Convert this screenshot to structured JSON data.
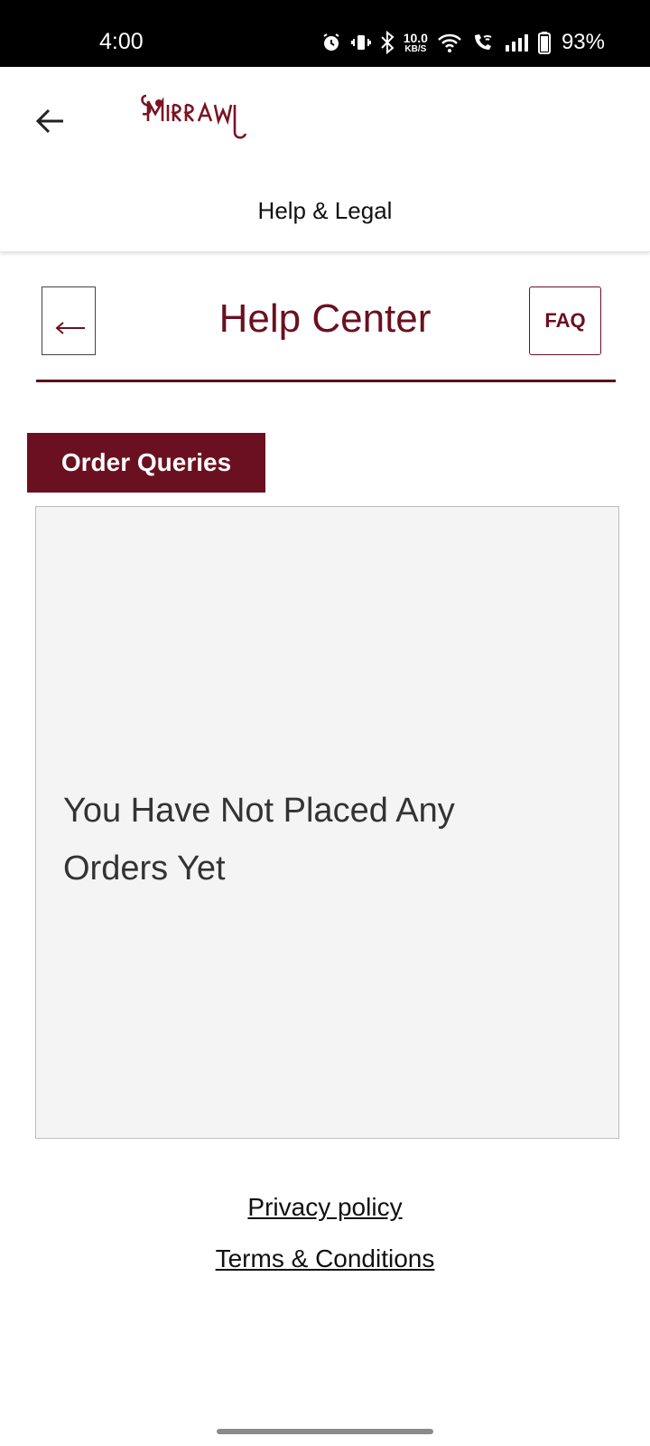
{
  "status_bar": {
    "time": "4:00",
    "net_speed_value": "10.0",
    "net_speed_unit": "KB/S",
    "battery": "93%",
    "icons": [
      "alarm-icon",
      "vibrate-icon",
      "bluetooth-icon",
      "wifi-icon",
      "wifi-calling-icon",
      "signal-icon",
      "battery-icon"
    ]
  },
  "header": {
    "brand": "MIRRAW",
    "subtitle": "Help & Legal"
  },
  "help_center": {
    "title": "Help Center",
    "faq_label": "FAQ",
    "back_glyph": "←"
  },
  "tabs": {
    "active_label": "Order Queries"
  },
  "orders": {
    "empty_message": "You Have Not Placed Any Orders Yet"
  },
  "footer": {
    "privacy_label": "Privacy policy",
    "terms_label": "Terms & Conditions"
  },
  "colors": {
    "brand": "#6b1020",
    "panel_bg": "#f4f4f4"
  }
}
